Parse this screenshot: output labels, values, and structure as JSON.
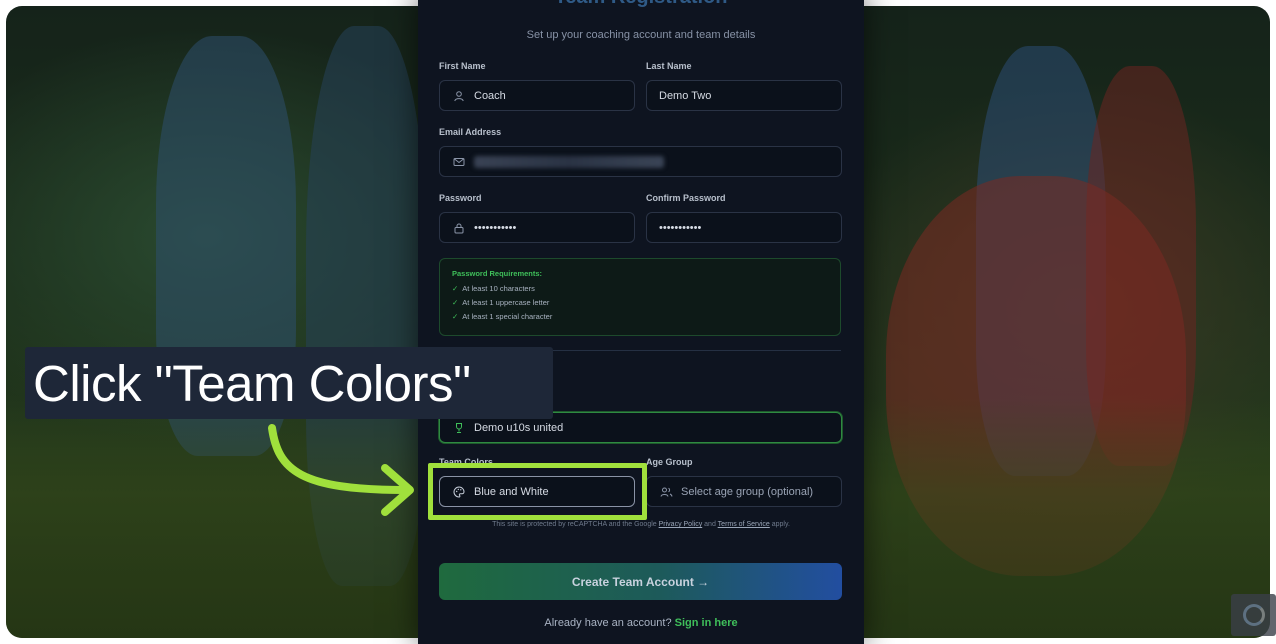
{
  "form": {
    "title": "Team Registration",
    "subtitle": "Set up your coaching account and team details",
    "first_name_label": "First Name",
    "first_name_value": "Coach",
    "last_name_label": "Last Name",
    "last_name_value": "Demo Two",
    "email_label": "Email Address",
    "password_label": "Password",
    "password_value": "•••••••••••",
    "confirm_password_label": "Confirm Password",
    "confirm_password_value": "•••••••••••",
    "requirements": {
      "title": "Password Requirements:",
      "items": [
        "At least 10 characters",
        "At least 1 uppercase letter",
        "At least 1 special character"
      ]
    },
    "team_name_value": "Demo u10s united",
    "team_colors_label": "Team Colors",
    "team_colors_value": "Blue and White",
    "age_group_label": "Age Group",
    "age_group_placeholder": "Select age group (optional)",
    "recaptcha": {
      "prefix": "This site is protected by reCAPTCHA and the Google",
      "privacy": "Privacy Policy",
      "and": "and",
      "terms": "Terms of Service",
      "suffix": "apply."
    },
    "submit_label": "Create Team Account →",
    "signin_prefix": "Already have an account?",
    "signin_link": "Sign in here"
  },
  "callout": {
    "text": "Click \"Team Colors\"",
    "highlight_color": "#a0e03c"
  },
  "icons": {
    "user": "user-icon",
    "mail": "mail-icon",
    "lock": "lock-icon",
    "trophy": "trophy-icon",
    "palette": "palette-icon",
    "users": "users-icon"
  }
}
